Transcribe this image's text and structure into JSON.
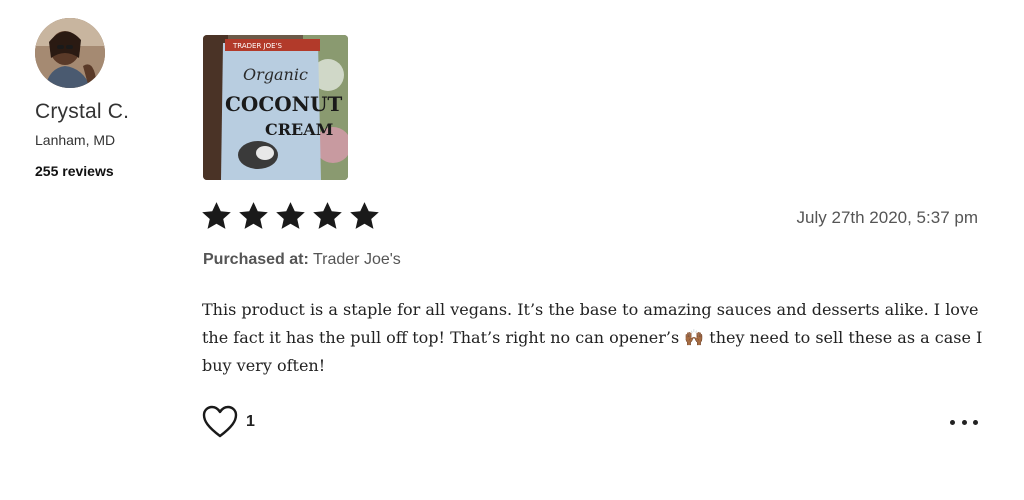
{
  "reviewer": {
    "name": "Crystal C.",
    "location": "Lanham, MD",
    "review_count": "255 reviews",
    "avatar_icon": "user-avatar-photo"
  },
  "product_image": {
    "icon": "coconut-cream-can-photo",
    "label_lines": [
      "TRADER JOE'S",
      "Organic",
      "COCONUT",
      "CREAM"
    ]
  },
  "review": {
    "rating": 5,
    "rating_max": 5,
    "star_color": "#1a1a1a",
    "date": "July 27th 2020, 5:37 pm",
    "purchased_label": "Purchased at:",
    "purchased_store": "Trader Joe's",
    "text": "This product is a staple for all vegans. It’s the base to amazing sauces and desserts alike. I love the fact it has the pull off top! That’s right no can opener’s 🙌🏾 they need to sell these as a case I buy very often!",
    "likes": "1"
  },
  "actions": {
    "like_icon": "heart-icon",
    "more_icon": "more-options-icon"
  }
}
